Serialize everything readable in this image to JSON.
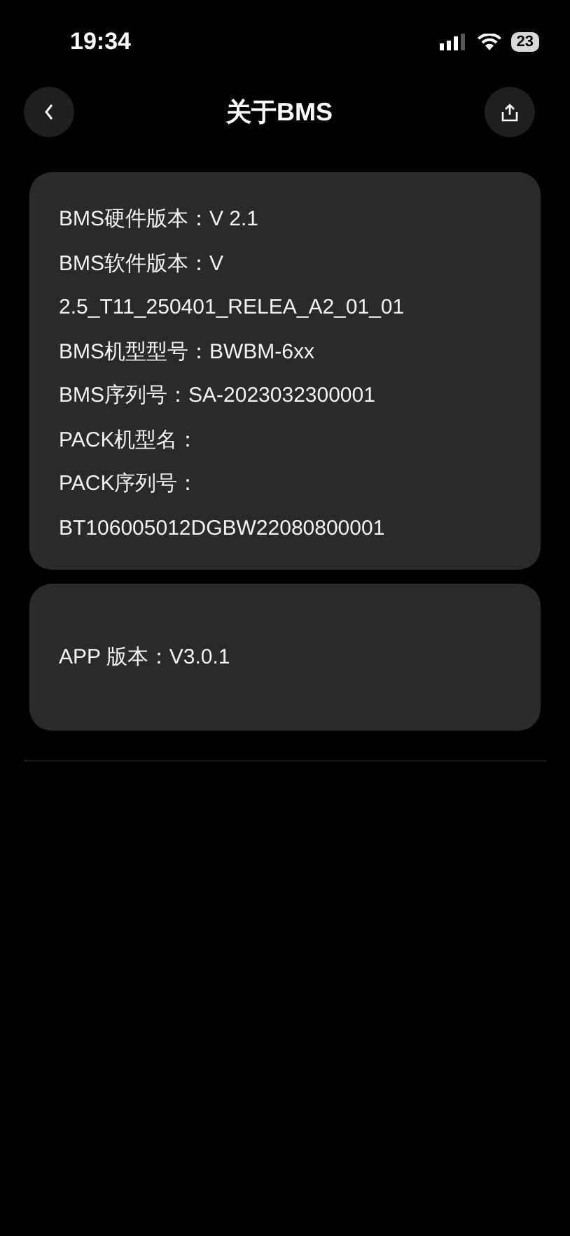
{
  "status_bar": {
    "time": "19:34",
    "battery": "23"
  },
  "header": {
    "title": "关于BMS"
  },
  "device_info": [
    "BMS硬件版本：V 2.1",
    "BMS软件版本：V 2.5_T11_250401_RELEA_A2_01_01",
    "BMS机型型号：BWBM-6xx",
    "BMS序列号：SA-2023032300001",
    "PACK机型名：",
    "PACK序列号： BT106005012DGBW22080800001"
  ],
  "app_info": [
    "APP 版本：V3.0.1"
  ]
}
